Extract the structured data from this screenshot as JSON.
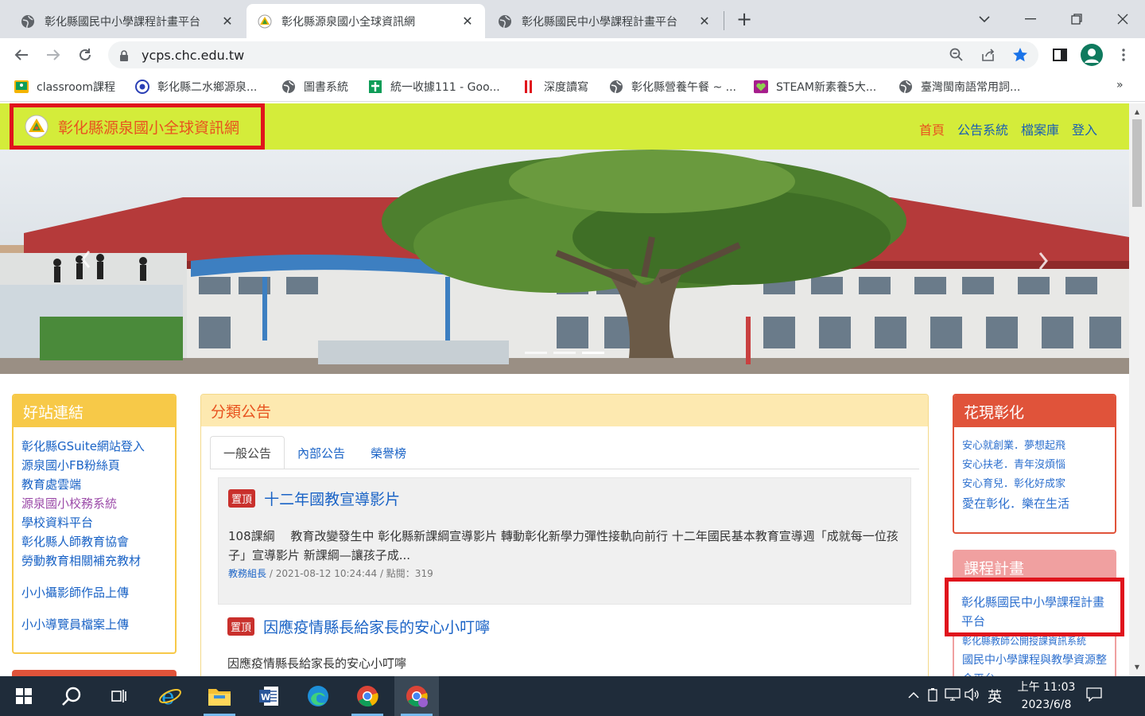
{
  "browser": {
    "tabs": [
      {
        "title": "彰化縣國民中小學課程計畫平台",
        "active": false
      },
      {
        "title": "彰化縣源泉國小全球資訊網",
        "active": true
      },
      {
        "title": "彰化縣國民中小學課程計畫平台",
        "active": false
      }
    ],
    "close_glyph": "✕",
    "new_tab_glyph": "+",
    "url": "ycps.chc.edu.tw",
    "bookmarks": [
      {
        "label": "classroom課程"
      },
      {
        "label": "彰化縣二水鄉源泉..."
      },
      {
        "label": "圖書系統"
      },
      {
        "label": "統一收據111 - Goo..."
      },
      {
        "label": "深度讀寫"
      },
      {
        "label": "彰化縣營養午餐 ~ ..."
      },
      {
        "label": "STEAM新素養5大..."
      },
      {
        "label": "臺灣閩南語常用詞..."
      }
    ],
    "bookmarks_more": "»"
  },
  "site": {
    "name": "彰化縣源泉國小全球資訊網",
    "nav": [
      "首頁",
      "公告系統",
      "檔案庫",
      "登入"
    ],
    "nav_active_color": "#e8531f"
  },
  "left_panel": {
    "title": "好站連結",
    "links": [
      "彰化縣GSuite網站登入",
      "源泉國小FB粉絲頁",
      "教育處雲端",
      "源泉國小校務系統",
      "學校資料平台",
      "彰化縣人師教育協會",
      "勞動教育相關補充教材",
      "小小攝影師作品上傳",
      "小小導覽員檔案上傳"
    ]
  },
  "center_panel": {
    "title": "分類公告",
    "tabs": [
      "一般公告",
      "內部公告",
      "榮譽榜"
    ],
    "badge": "置頂",
    "news": [
      {
        "title": "十二年國教宣導影片",
        "summary": "108課綱　 教育改變發生中 彰化縣新課綱宣導影片 轉動彰化新學力彈性接軌向前行 十二年國民基本教育宣導週「成就每一位孩子」宣導影片 新課綱—讓孩子成...",
        "author": "教務組長",
        "meta": " / 2021-08-12 10:24:44 / 點閱：319"
      },
      {
        "title": "因應疫情縣長給家長的安心小叮嚀",
        "summary": "因應疫情縣長給家長的安心小叮嚀"
      }
    ]
  },
  "right_panel_1": {
    "title": "花現彰化",
    "links": [
      "安心就創業．夢想起飛",
      "安心扶老．青年沒煩惱",
      "安心育兒．彰化好成家",
      "愛在彰化．樂在生活"
    ]
  },
  "right_panel_2": {
    "title": "課程計畫",
    "links": [
      "彰化縣國民中小學課程計畫平台",
      "彰化縣教師公開授課資訊系統",
      "國民中小學課程與教學資源整合平台"
    ]
  },
  "taskbar": {
    "time": "上午 11:03",
    "date": "2023/6/8",
    "ime": "英"
  },
  "colors": {
    "header_bg": "#d4ec3a",
    "left_head": "#f7c948",
    "center_head": "#fde9b0",
    "right1_head": "#e0533a",
    "right2_head": "#f0a0a0",
    "highlight": "#e0141c"
  }
}
